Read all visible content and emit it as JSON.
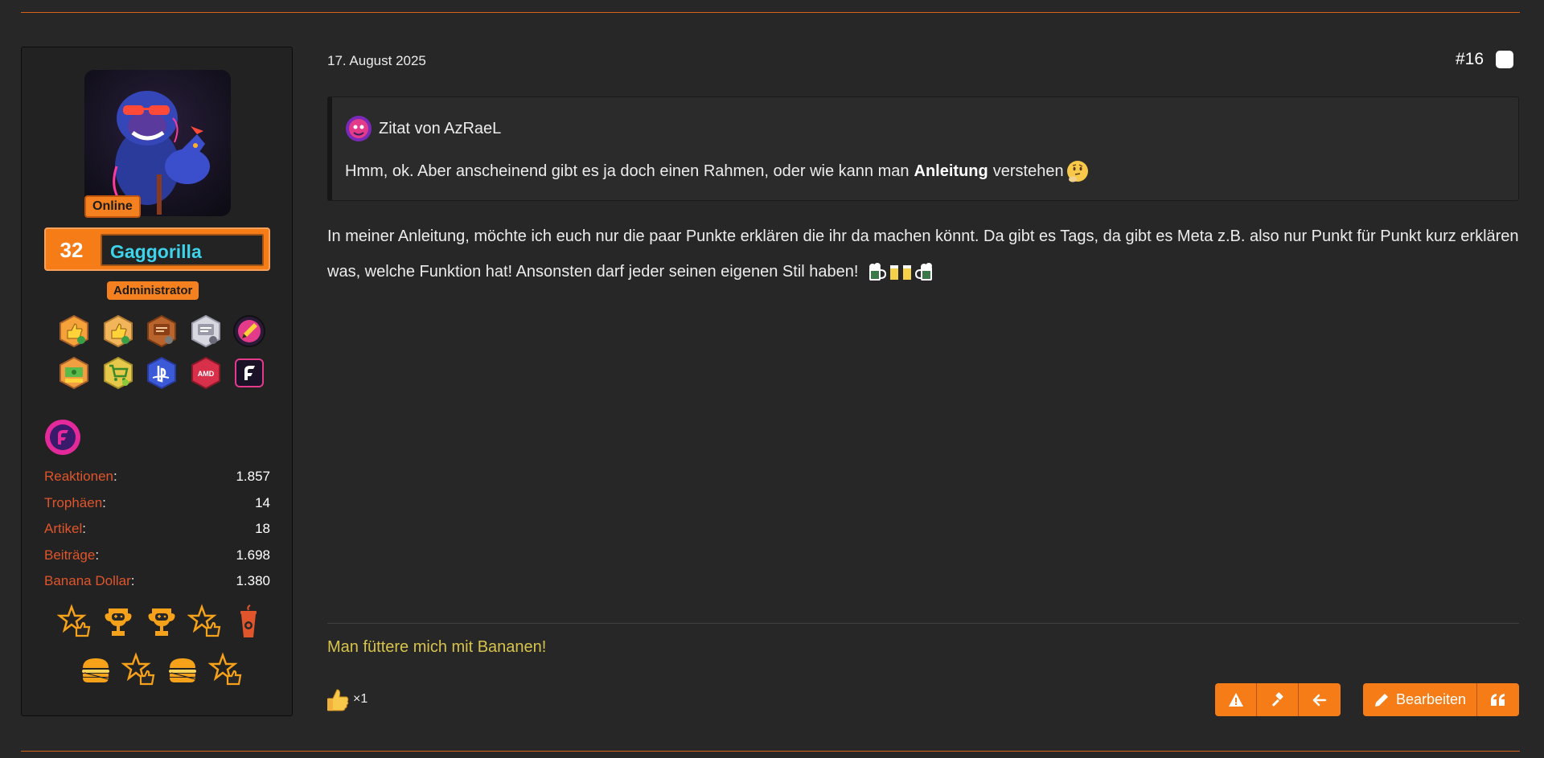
{
  "post": {
    "date": "17. August 2025",
    "number": "#16",
    "quote": {
      "author_line": "Zitat von AzRaeL",
      "text_before": "Hmm, ok. Aber anscheinend gibt es ja doch einen Rahmen, oder wie kann man",
      "text_bold": "Anleitung",
      "text_after": "verstehen"
    },
    "body": "In meiner Anleitung, möchte ich euch nur die paar Punkte erklären die ihr da machen könnt. Da gibt es Tags, da gibt es Meta z.B. also nur Punkt für Punkt kurz erklären was, welche Funktion hat! Ansonsten darf jeder seinen eigenen Stil haben!",
    "signature": "Man füttere mich mit Bananen!",
    "reactions": {
      "count": "×1"
    },
    "buttons": {
      "edit_label": "Bearbeiten"
    }
  },
  "author": {
    "online_label": "Online",
    "level": "32",
    "username": "Gaggorilla",
    "role": "Administrator",
    "stats": [
      {
        "label": "Reaktionen",
        "value": "1.857"
      },
      {
        "label": "Trophäen",
        "value": "14"
      },
      {
        "label": "Artikel",
        "value": "18"
      },
      {
        "label": "Beiträge",
        "value": "1.698"
      },
      {
        "label": "Banana Dollar",
        "value": "1.380"
      }
    ],
    "trophies_row1": [
      "thumbs-up-100-trophy-icon",
      "thumbs-up-500-trophy-icon",
      "posts-300-trophy-icon",
      "posts-1000-trophy-icon",
      "pencil-trophy-icon"
    ],
    "trophies_row2": [
      "money-1000-trophy-icon",
      "shopping-cart-50-trophy-icon",
      "playstation-trophy-icon",
      "amd-trophy-icon",
      "brand-f-trophy-icon"
    ],
    "awards_row1": [
      "star-hand-award-icon",
      "gamepad-trophy-award-icon",
      "gamepad-trophy-award-icon",
      "star-hand-award-icon",
      "coffee-cup-award-icon"
    ],
    "awards_row2": [
      "burger-award-icon",
      "star-hand-award-icon",
      "burger-award-icon",
      "star-hand-award-icon"
    ]
  },
  "colors": {
    "accent": "#f57c17",
    "stat_label": "#e0552b",
    "username": "#3ed3ea",
    "signature": "#d7c34c",
    "background": "#272727"
  }
}
